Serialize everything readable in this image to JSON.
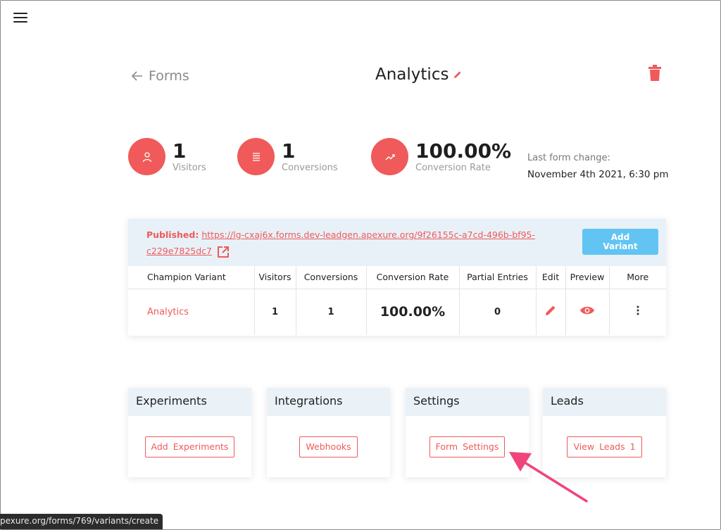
{
  "header": {
    "back_label": "Forms",
    "title": "Analytics"
  },
  "stats": [
    {
      "value": "1",
      "label": "Visitors",
      "icon": "person-icon"
    },
    {
      "value": "1",
      "label": "Conversions",
      "icon": "list-icon"
    },
    {
      "value": "100.00%",
      "label": "Conversion Rate",
      "icon": "trending-up-icon"
    }
  ],
  "last_change": {
    "label": "Last form change:",
    "value": "November 4th 2021, 6:30 pm"
  },
  "published": {
    "label": "Published:",
    "url_line1": "https://lg-cxaj6x.forms.dev-leadgen.apexure.org/9f26155c-a7cd-496b-bf95-",
    "url_line2": "c229e7825dc7"
  },
  "add_variant_label_1": "Add",
  "add_variant_label_2": "Variant",
  "table": {
    "headers": [
      "Champion Variant",
      "Visitors",
      "Conversions",
      "Conversion Rate",
      "Partial Entries",
      "Edit",
      "Preview",
      "More"
    ],
    "row": {
      "name": "Analytics",
      "visitors": "1",
      "conversions": "1",
      "conversion_rate": "100.00%",
      "partial_entries": "0"
    }
  },
  "panels": [
    {
      "title": "Experiments",
      "button": "Add Experiments"
    },
    {
      "title": "Integrations",
      "button": "Webhooks"
    },
    {
      "title": "Settings",
      "button": "Form Settings"
    },
    {
      "title": "Leads",
      "button": "View Leads 1"
    }
  ],
  "status_bar": "pexure.org/forms/769/variants/create",
  "colors": {
    "accent": "#f05a5a",
    "primary_button": "#62c4f2",
    "header_bg": "#e8f1f8",
    "annotation_arrow": "#f0447a"
  }
}
